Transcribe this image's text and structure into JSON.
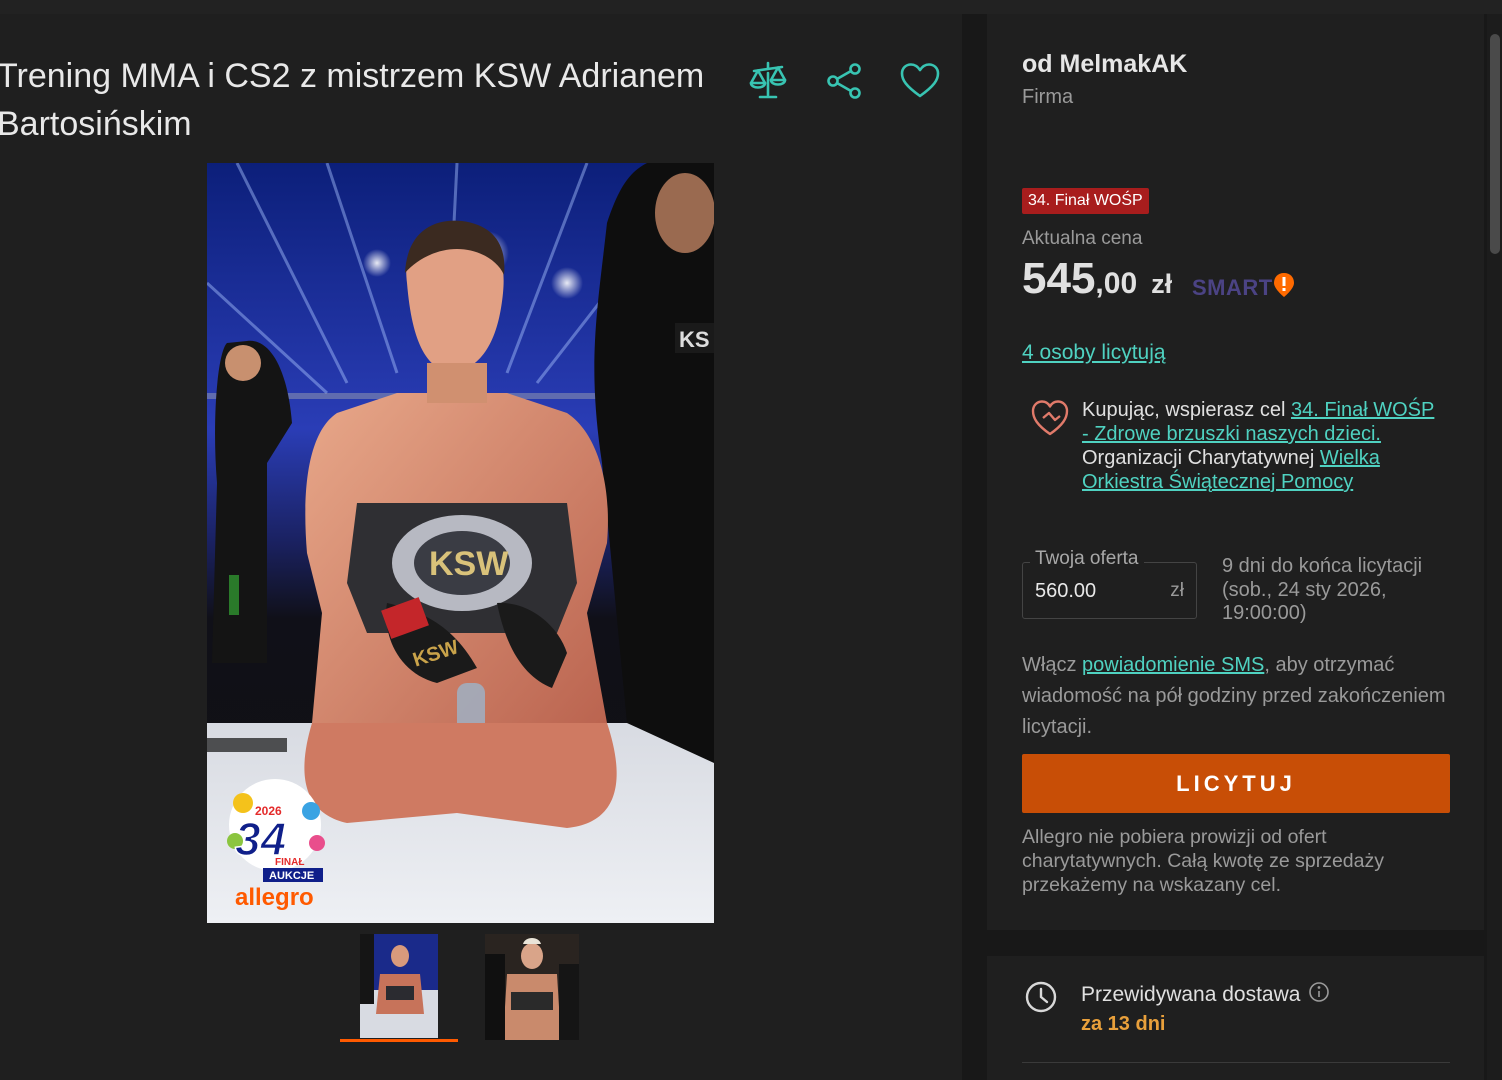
{
  "listing": {
    "title": "Trening MMA i CS2 z mistrzem KSW Adrianem Bartosińskim",
    "image_alt": "Zawodnik MMA klęczący z pasem mistrzowskim KSW",
    "logo": {
      "year": "2026",
      "number": "34",
      "line1": "FINAŁ",
      "line2": "AUKCJE",
      "brand": "allegro"
    },
    "thumbnails": [
      {
        "alt": "Zdjęcie 1",
        "active": true
      },
      {
        "alt": "Zdjęcie 2",
        "active": false
      }
    ]
  },
  "actions": {
    "compare": "compare-icon",
    "share": "share-icon",
    "favorite": "heart-icon"
  },
  "seller": {
    "name": "od MelmakAK",
    "type": "Firma"
  },
  "badge": "34. Finał WOŚP",
  "price": {
    "label": "Aktualna cena",
    "integer": "545",
    "decimal": ",00",
    "currency": "zł",
    "smart_label": "SMART"
  },
  "bidders_link": "4 osoby licytują",
  "charity": {
    "prefix": "Kupując, wspierasz cel ",
    "goal_link": "34. Finał WOŚP - Zdrowe brzuszki naszych dzieci.",
    "org_prefix": " Organizacji Charytatywnej ",
    "org_link": "Wielka Orkiestra Świątecznej Pomocy"
  },
  "offer": {
    "label": "Twoja oferta",
    "value": "560.00",
    "currency": "zł",
    "time_left": "9 dni do końca licytacji (sob., 24 sty 2026, 19:00:00)"
  },
  "sms": {
    "prefix": "Włącz ",
    "link": "powiadomienie SMS",
    "suffix": ", aby otrzymać wiadomość na pół godziny przed zakończeniem licytacji."
  },
  "bid_button": "LICYTUJ",
  "note": "Allegro nie pobiera prowizji od ofert charytatywnych. Całą kwotę ze sprzedaży przekażemy na wskazany cel.",
  "delivery": {
    "label": "Przewidywana dostawa",
    "value": "za 13 dni"
  },
  "colors": {
    "accent": "#4fd2c1",
    "button": "#c84e06",
    "badge": "#a81d1d",
    "delivery": "#e9a03b",
    "smart": "#4b4384"
  }
}
